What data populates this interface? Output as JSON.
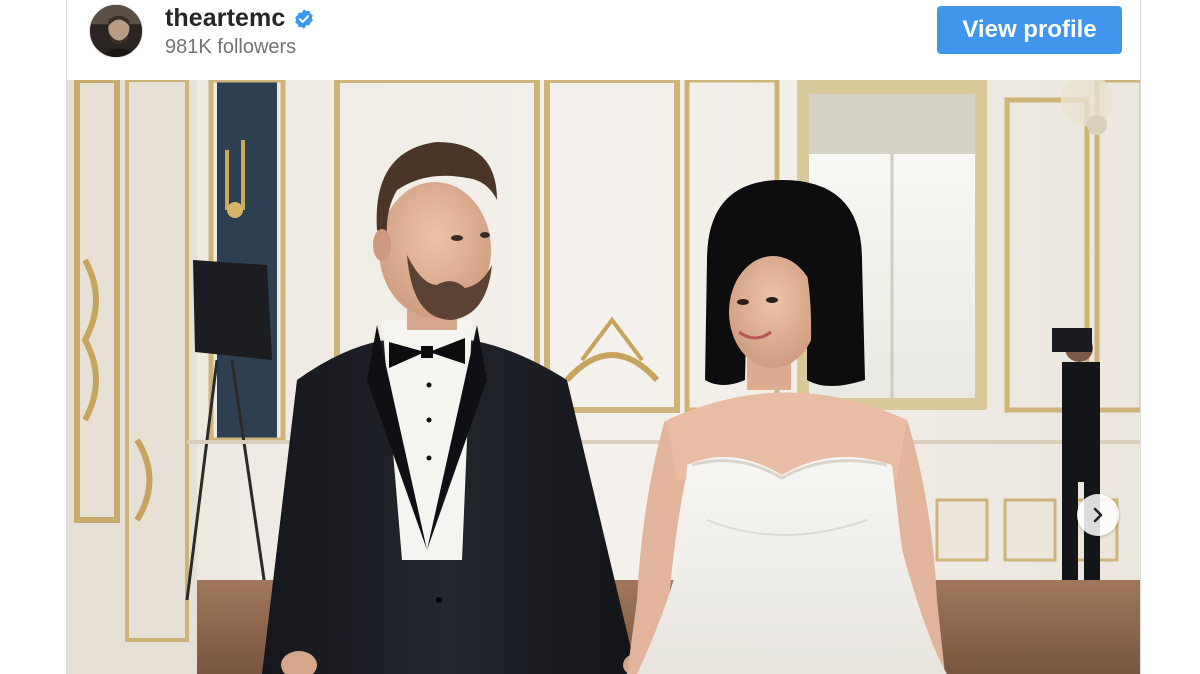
{
  "profile": {
    "username": "theartemc",
    "followers": "981K followers",
    "verified": true,
    "avatar_icon": "profile-avatar"
  },
  "actions": {
    "view_profile_label": "View profile"
  },
  "post": {
    "media_type": "photo",
    "carousel_next_icon": "chevron-right-icon"
  },
  "colors": {
    "button_blue": "#4095ec",
    "verified_blue": "#3897f0",
    "username": "#262626",
    "secondary_text": "#737373"
  }
}
